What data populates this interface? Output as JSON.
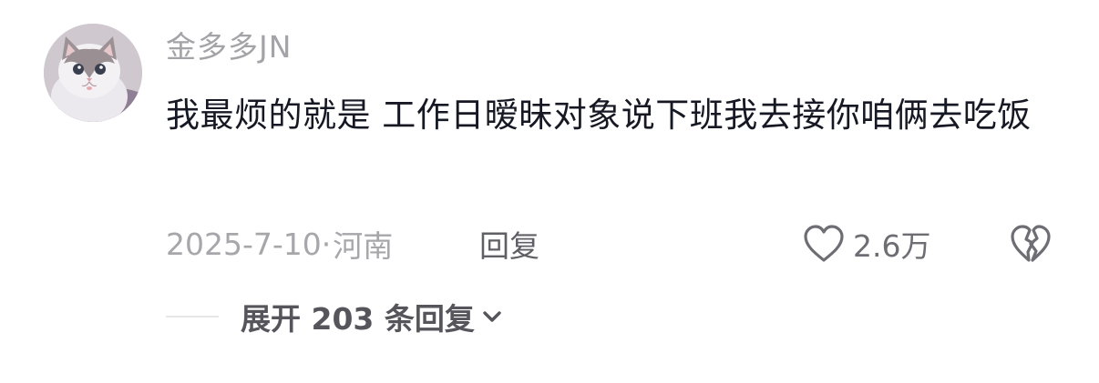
{
  "comment": {
    "username": "金多多JN",
    "text": "我最烦的就是 工作日暧昧对象说下班我去接你咱俩去吃饭",
    "date": "2025-7-10",
    "separator": "·",
    "location": "河南",
    "reply_label": "回复",
    "like_count": "2.6万",
    "expand_label": "展开 203 条回复",
    "icons": {
      "avatar": "cat-avatar",
      "like": "heart-outline-icon",
      "dislike": "broken-heart-icon",
      "expand": "chevron-down-icon"
    },
    "colors": {
      "text": "#161823",
      "muted": "#a7a7ab",
      "action": "#5f5f66"
    }
  }
}
